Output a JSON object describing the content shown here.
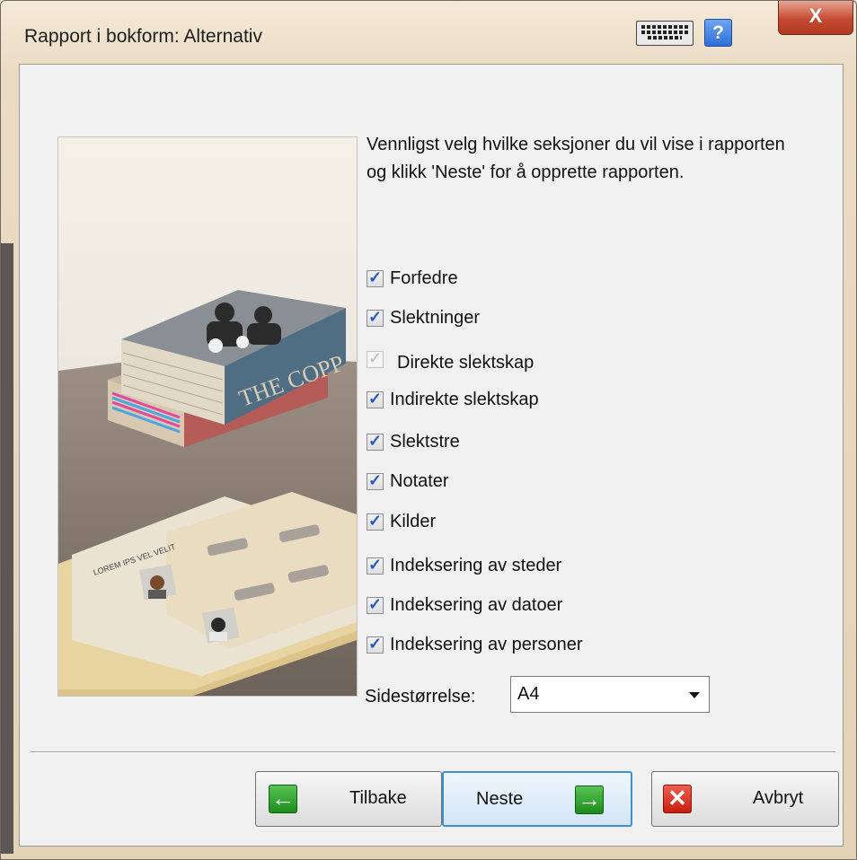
{
  "window": {
    "title": "Rapport i bokform: Alternativ",
    "help_label": "?",
    "close_label": "X"
  },
  "illustration": {
    "book_spine_text": "THE COPP",
    "page_heading_text": "LOREM IPS VEL VELIT"
  },
  "intro_text": "Vennligst velg hvilke seksjoner du vil vise i rapporten og klikk 'Neste' for å opprette rapporten.",
  "options": [
    {
      "label": "Forfedre",
      "checked": true,
      "enabled": true
    },
    {
      "label": "Slektninger",
      "checked": true,
      "enabled": true
    },
    {
      "label": "Direkte slektskap",
      "checked": true,
      "enabled": false
    },
    {
      "label": "Indirekte slektskap",
      "checked": true,
      "enabled": true
    },
    {
      "label": "Slektstre",
      "checked": true,
      "enabled": true
    },
    {
      "label": "Notater",
      "checked": true,
      "enabled": true
    },
    {
      "label": "Kilder",
      "checked": true,
      "enabled": true
    },
    {
      "label": "Indeksering av steder",
      "checked": true,
      "enabled": true
    },
    {
      "label": "Indeksering av datoer",
      "checked": true,
      "enabled": true
    },
    {
      "label": "Indeksering av personer",
      "checked": true,
      "enabled": true
    }
  ],
  "page_size": {
    "label": "Sidestørrelse:",
    "value": "A4"
  },
  "buttons": {
    "back": "Tilbake",
    "next": "Neste",
    "cancel": "Avbryt"
  },
  "colors": {
    "check_mark": "#2456c6",
    "focus_border": "#3c8fd0",
    "green_icon": "#1c8c1c",
    "red_icon": "#c81f10",
    "close_button": "#c44b31"
  },
  "icons": {
    "keyboard": "keyboard-icon",
    "help": "help-icon",
    "close": "close-icon",
    "back": "arrow-left-icon",
    "next": "arrow-right-icon",
    "cancel": "x-icon"
  }
}
